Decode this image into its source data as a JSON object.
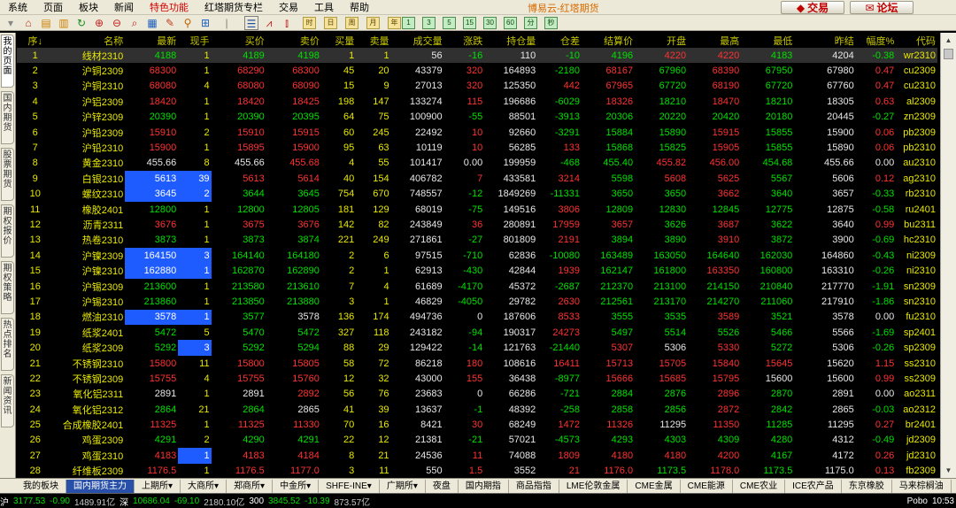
{
  "menu": {
    "items": [
      "系统",
      "页面",
      "板块",
      "新闻",
      "特色功能",
      "红塔期货专栏",
      "交易",
      "工具",
      "帮助"
    ],
    "highlight_index": 4
  },
  "app_title": "博易云-红塔期货",
  "buttons": {
    "trade": "交易",
    "forum": "论坛"
  },
  "toolbar": {
    "period_buttons": [
      "时",
      "日",
      "周",
      "月",
      "年"
    ],
    "interval_buttons": [
      "1",
      "3",
      "5",
      "15",
      "30",
      "60",
      "分",
      "秒"
    ]
  },
  "side_tabs": [
    "我的页面",
    "国内期货",
    "股票期货",
    "期权报价",
    "期权策略",
    "热点排名",
    "新闻资讯"
  ],
  "table": {
    "headers": [
      "序↓",
      "名称",
      "最新",
      "现手",
      "买价",
      "卖价",
      "买量",
      "卖量",
      "成交量",
      "涨跌",
      "持仓量",
      "仓差",
      "结算价",
      "开盘",
      "最高",
      "最低",
      "昨结",
      "幅度%",
      "代码"
    ],
    "rows": [
      [
        "1",
        "线材2310",
        "4188",
        "1",
        "4189",
        "4198",
        "1",
        "1",
        "56",
        "-16",
        "110",
        "-10",
        "4196",
        "4220",
        "4220",
        "4183",
        "4204",
        "-0.38",
        "wr2310"
      ],
      [
        "2",
        "沪铜2309",
        "68300",
        "1",
        "68290",
        "68300",
        "45",
        "20",
        "43379",
        "320",
        "164893",
        "-2180",
        "68167",
        "67960",
        "68390",
        "67950",
        "67980",
        "0.47",
        "cu2309"
      ],
      [
        "3",
        "沪铜2310",
        "68080",
        "4",
        "68080",
        "68090",
        "15",
        "9",
        "27013",
        "320",
        "125350",
        "442",
        "67965",
        "67720",
        "68190",
        "67720",
        "67760",
        "0.47",
        "cu2310"
      ],
      [
        "4",
        "沪铝2309",
        "18420",
        "1",
        "18420",
        "18425",
        "198",
        "147",
        "133274",
        "115",
        "196686",
        "-6029",
        "18326",
        "18210",
        "18470",
        "18210",
        "18305",
        "0.63",
        "al2309"
      ],
      [
        "5",
        "沪锌2309",
        "20390",
        "1",
        "20390",
        "20395",
        "64",
        "75",
        "100900",
        "-55",
        "88501",
        "-3913",
        "20306",
        "20220",
        "20420",
        "20180",
        "20445",
        "-0.27",
        "zn2309"
      ],
      [
        "6",
        "沪铅2309",
        "15910",
        "2",
        "15910",
        "15915",
        "60",
        "245",
        "22492",
        "10",
        "92660",
        "-3291",
        "15884",
        "15890",
        "15915",
        "15855",
        "15900",
        "0.06",
        "pb2309"
      ],
      [
        "7",
        "沪铅2310",
        "15900",
        "1",
        "15895",
        "15900",
        "95",
        "63",
        "10119",
        "10",
        "56285",
        "133",
        "15868",
        "15825",
        "15905",
        "15855",
        "15890",
        "0.06",
        "pb2310"
      ],
      [
        "8",
        "黄金2310",
        "455.66",
        "8",
        "455.66",
        "455.68",
        "4",
        "55",
        "101417",
        "0.00",
        "199959",
        "-468",
        "455.40",
        "455.82",
        "456.00",
        "454.68",
        "455.66",
        "0.00",
        "au2310"
      ],
      [
        "9",
        "白银2310",
        "5613",
        "39",
        "5613",
        "5614",
        "40",
        "154",
        "406782",
        "7",
        "433581",
        "3214",
        "5598",
        "5608",
        "5625",
        "5567",
        "5606",
        "0.12",
        "ag2310"
      ],
      [
        "10",
        "螺纹2310",
        "3645",
        "2",
        "3644",
        "3645",
        "754",
        "670",
        "748557",
        "-12",
        "1849269",
        "-11331",
        "3650",
        "3650",
        "3662",
        "3640",
        "3657",
        "-0.33",
        "rb2310"
      ],
      [
        "11",
        "橡胶2401",
        "12800",
        "1",
        "12800",
        "12805",
        "181",
        "129",
        "68019",
        "-75",
        "149516",
        "3806",
        "12809",
        "12830",
        "12845",
        "12775",
        "12875",
        "-0.58",
        "ru2401"
      ],
      [
        "12",
        "沥青2311",
        "3676",
        "1",
        "3675",
        "3676",
        "142",
        "82",
        "243849",
        "36",
        "280891",
        "17959",
        "3657",
        "3626",
        "3687",
        "3622",
        "3640",
        "0.99",
        "bu2311"
      ],
      [
        "13",
        "热卷2310",
        "3873",
        "1",
        "3873",
        "3874",
        "221",
        "249",
        "271861",
        "-27",
        "801809",
        "2191",
        "3894",
        "3890",
        "3910",
        "3872",
        "3900",
        "-0.69",
        "hc2310"
      ],
      [
        "14",
        "沪镍2309",
        "164150",
        "3",
        "164140",
        "164180",
        "2",
        "6",
        "97515",
        "-710",
        "62836",
        "-10080",
        "163489",
        "163050",
        "164640",
        "162030",
        "164860",
        "-0.43",
        "ni2309"
      ],
      [
        "15",
        "沪镍2310",
        "162880",
        "1",
        "162870",
        "162890",
        "2",
        "1",
        "62913",
        "-430",
        "42844",
        "1939",
        "162147",
        "161800",
        "163350",
        "160800",
        "163310",
        "-0.26",
        "ni2310"
      ],
      [
        "16",
        "沪锡2309",
        "213600",
        "1",
        "213580",
        "213610",
        "7",
        "4",
        "61689",
        "-4170",
        "45372",
        "-2687",
        "212370",
        "213100",
        "214150",
        "210840",
        "217770",
        "-1.91",
        "sn2309"
      ],
      [
        "17",
        "沪锡2310",
        "213860",
        "1",
        "213850",
        "213880",
        "3",
        "1",
        "46829",
        "-4050",
        "29782",
        "2630",
        "212561",
        "213170",
        "214270",
        "211060",
        "217910",
        "-1.86",
        "sn2310"
      ],
      [
        "18",
        "燃油2310",
        "3578",
        "1",
        "3577",
        "3578",
        "136",
        "174",
        "494736",
        "0",
        "187606",
        "8533",
        "3555",
        "3535",
        "3589",
        "3521",
        "3578",
        "0.00",
        "fu2310"
      ],
      [
        "19",
        "纸浆2401",
        "5472",
        "5",
        "5470",
        "5472",
        "327",
        "118",
        "243182",
        "-94",
        "190317",
        "24273",
        "5497",
        "5514",
        "5526",
        "5466",
        "5566",
        "-1.69",
        "sp2401"
      ],
      [
        "20",
        "纸浆2309",
        "5292",
        "3",
        "5292",
        "5294",
        "88",
        "29",
        "129422",
        "-14",
        "121763",
        "-21440",
        "5307",
        "5306",
        "5330",
        "5272",
        "5306",
        "-0.26",
        "sp2309"
      ],
      [
        "21",
        "不锈钢2310",
        "15800",
        "11",
        "15800",
        "15805",
        "58",
        "72",
        "86218",
        "180",
        "108616",
        "16411",
        "15713",
        "15705",
        "15840",
        "15645",
        "15620",
        "1.15",
        "ss2310"
      ],
      [
        "22",
        "不锈钢2309",
        "15755",
        "4",
        "15755",
        "15760",
        "12",
        "32",
        "43000",
        "155",
        "36438",
        "-8977",
        "15666",
        "15685",
        "15795",
        "15600",
        "15600",
        "0.99",
        "ss2309"
      ],
      [
        "23",
        "氧化铝2311",
        "2891",
        "1",
        "2891",
        "2892",
        "56",
        "76",
        "23683",
        "0",
        "66286",
        "-721",
        "2884",
        "2876",
        "2896",
        "2870",
        "2891",
        "0.00",
        "ao2311"
      ],
      [
        "24",
        "氧化铝2312",
        "2864",
        "21",
        "2864",
        "2865",
        "41",
        "39",
        "13637",
        "-1",
        "48392",
        "-258",
        "2858",
        "2856",
        "2872",
        "2842",
        "2865",
        "-0.03",
        "ao2312"
      ],
      [
        "25",
        "合成橡胶2401",
        "11325",
        "1",
        "11325",
        "11330",
        "70",
        "16",
        "8421",
        "30",
        "68249",
        "1472",
        "11326",
        "11295",
        "11350",
        "11285",
        "11295",
        "0.27",
        "br2401"
      ],
      [
        "26",
        "鸡蛋2309",
        "4291",
        "2",
        "4290",
        "4291",
        "22",
        "12",
        "21381",
        "-21",
        "57021",
        "-4573",
        "4293",
        "4303",
        "4309",
        "4280",
        "4312",
        "-0.49",
        "jd2309"
      ],
      [
        "27",
        "鸡蛋2310",
        "4183",
        "1",
        "4183",
        "4184",
        "8",
        "21",
        "24536",
        "11",
        "74088",
        "1809",
        "4180",
        "4180",
        "4200",
        "4167",
        "4172",
        "0.26",
        "jd2310"
      ],
      [
        "28",
        "纤维板2309",
        "1176.5",
        "1",
        "1176.5",
        "1177.0",
        "3",
        "11",
        "550",
        "1.5",
        "3552",
        "21",
        "1176.0",
        "1173.5",
        "1178.0",
        "1173.5",
        "1175.0",
        "0.13",
        "fb2309"
      ]
    ],
    "highlight_last": [
      9,
      10,
      14,
      15,
      18
    ],
    "highlight_vol": [
      9,
      10,
      14,
      15,
      18,
      20,
      27
    ]
  },
  "bottom_tabs": [
    "我的板块",
    "国内期货主力",
    "上期所▾",
    "大商所▾",
    "郑商所▾",
    "中金所▾",
    "SHFE-INE▾",
    "广期所▾",
    "夜盘",
    "国内期指",
    "商品指指",
    "LME伦敦金属",
    "CME金属",
    "CME能源",
    "CME农业",
    "ICE农产品",
    "东京橡胶",
    "马来棕榈油"
  ],
  "status": {
    "items": [
      "沪",
      "3177.53",
      "-0.90",
      "1489.91亿",
      "深",
      "10686.04",
      "-69.10",
      "2180.10亿",
      "300",
      "3845.52",
      "-10.39",
      "873.57亿"
    ],
    "right": [
      "Pobo",
      "10:53"
    ]
  },
  "colors": {
    "up": "#ff3232",
    "down": "#00e000",
    "flat": "#e8e8e8",
    "label": "#e8e800",
    "highlight": "#1e5cff"
  }
}
